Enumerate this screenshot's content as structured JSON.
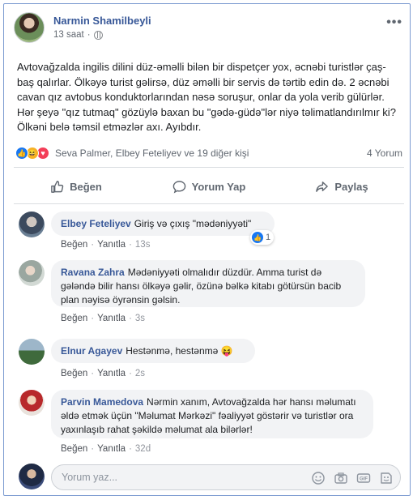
{
  "post": {
    "author": "Narmin Shamilbeyli",
    "time": "13 saat",
    "separator": "·",
    "body": "Avtovağzalda ingilis dilini düz-əməlli bilən bir dispetçer yox, əcnəbi turistlər çaş-baş qalırlar. Ölkəyə turist gəlirsə, düz əməlli bir servis də tərtib edin də. 2 əcnəbi cavan qız avtobus konduktorlarından nəsə soruşur, onlar da yola verib gülürlər. Hər şeyə \"qız tutmaq\" gözüylə baxan bu \"gədə-güdə\"lər niyə təlimatlandırılmır ki? Ölkəni belə təmsil etməzlər axı. Ayıbdır.",
    "reaction_names": "Seva Palmer, Elbey Feteliyev ve 19 diğer kişi",
    "comment_count": "4 Yorum"
  },
  "actions": {
    "like": "Beğen",
    "comment": "Yorum Yap",
    "share": "Paylaş"
  },
  "comments": [
    {
      "name": "Elbey Feteliyev",
      "text": "Giriş və çıxış \"mədəniyyəti\"",
      "like": "Beğen",
      "reply": "Yanıtla",
      "time": "13s",
      "reactions": "1"
    },
    {
      "name": "Ravana Zahra",
      "text": "Mədəniyyəti olmalıdır düzdür. Amma turist də gələndə bilir hansı ölkəyə gəlir, özünə bəlkə kitabı götürsün bacib plan nəyisə öyrənsin gəlsin.",
      "like": "Beğen",
      "reply": "Yanıtla",
      "time": "3s"
    },
    {
      "name": "Elnur Agayev",
      "text": "Hestənmə, hestənmə",
      "like": "Beğen",
      "reply": "Yanıtla",
      "time": "2s"
    },
    {
      "name": "Parvin Mamedova",
      "text": "Nərmin xanım, Avtovağzalda hər hansı məlumatı əldə etmək üçün \"Məlumat Mərkəzi\" fəaliyyət göstərir və turistlər ora yaxınlaşıb rahat şəkildə məlumat ala bilərlər!",
      "like": "Beğen",
      "reply": "Yanıtla",
      "time": "32d"
    }
  ],
  "composer": {
    "placeholder": "Yorum yaz..."
  },
  "colors": {
    "link": "#385898",
    "bubble": "#f2f3f5",
    "like_blue": "#1877f2",
    "love_red": "#f33e58",
    "haha_yellow": "#f7b125"
  },
  "icons": [
    "globe-icon",
    "more-dots-icon",
    "like-reaction-icon",
    "haha-reaction-icon",
    "love-reaction-icon",
    "thumbs-up-icon",
    "comment-icon",
    "share-icon",
    "emoji-icon",
    "camera-icon",
    "gif-icon",
    "sticker-icon"
  ]
}
